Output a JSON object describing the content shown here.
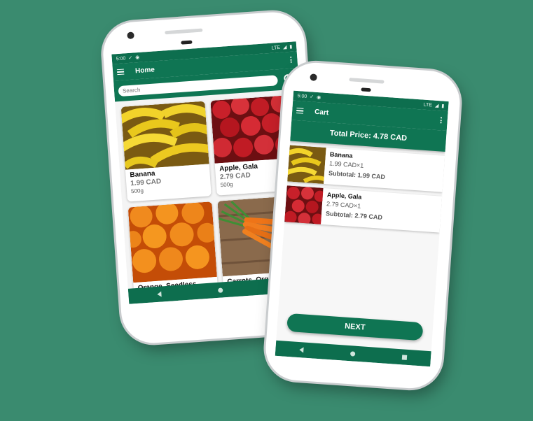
{
  "home_screen": {
    "status_time": "5:00",
    "status_network": "LTE",
    "title": "Home",
    "search": {
      "placeholder": "Search"
    },
    "products": [
      {
        "name": "Banana",
        "price": "1.99 CAD",
        "weight": "500g",
        "image": "banana-photo"
      },
      {
        "name": "Apple, Gala",
        "price": "2.79 CAD",
        "weight": "500g",
        "image": "apple-photo"
      },
      {
        "name": "Orange, Seedless",
        "image": "orange-photo"
      },
      {
        "name": "Carrots, Organic",
        "image": "carrot-photo"
      }
    ],
    "fab_icon": "cart-icon"
  },
  "cart_screen": {
    "status_time": "5:00",
    "status_network": "LTE",
    "title": "Cart",
    "total_price": "Total Price: 4.78 CAD",
    "items": [
      {
        "name": "Banana",
        "qty": "1.99 CAD×1",
        "subtotal": "Subtotal: 1.99 CAD",
        "image": "banana-photo"
      },
      {
        "name": "Apple, Gala",
        "qty": "2.79 CAD×1",
        "subtotal": "Subtotal: 2.79 CAD",
        "image": "apple-photo"
      }
    ],
    "next_label": "NEXT"
  },
  "colors": {
    "background": "#3a8b6f",
    "primary": "#0f7553",
    "primary_dark": "#0d6e4e"
  }
}
